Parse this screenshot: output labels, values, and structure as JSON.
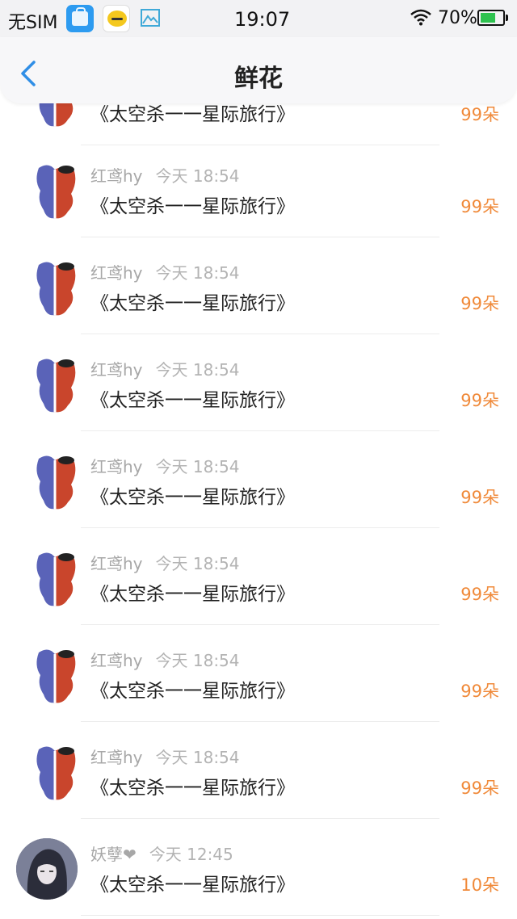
{
  "status_bar": {
    "carrier": "无SIM",
    "time": "19:07",
    "battery": "70%",
    "battery_fraction": 0.7,
    "icons": [
      "vivo-appstore-icon",
      "qq-icon",
      "gallery-icon",
      "wifi-icon",
      "battery-icon"
    ]
  },
  "header": {
    "title": "鲜花",
    "back_icon": "chevron-left-icon"
  },
  "colors": {
    "accent_blue": "#2f8ee6",
    "count_orange": "#f08a3a",
    "meta_gray": "#a7a7a7"
  },
  "partial_row": {
    "gift": "《太空杀一一星际旅行》",
    "count": "99朵"
  },
  "rows": [
    {
      "name": "红鸢hy",
      "time": "今天 18:54",
      "gift": "《太空杀一一星际旅行》",
      "count": "99朵"
    },
    {
      "name": "红鸢hy",
      "time": "今天 18:54",
      "gift": "《太空杀一一星际旅行》",
      "count": "99朵"
    },
    {
      "name": "红鸢hy",
      "time": "今天 18:54",
      "gift": "《太空杀一一星际旅行》",
      "count": "99朵"
    },
    {
      "name": "红鸢hy",
      "time": "今天 18:54",
      "gift": "《太空杀一一星际旅行》",
      "count": "99朵"
    },
    {
      "name": "红鸢hy",
      "time": "今天 18:54",
      "gift": "《太空杀一一星际旅行》",
      "count": "99朵"
    },
    {
      "name": "红鸢hy",
      "time": "今天 18:54",
      "gift": "《太空杀一一星际旅行》",
      "count": "99朵"
    },
    {
      "name": "红鸢hy",
      "time": "今天 18:54",
      "gift": "《太空杀一一星际旅行》",
      "count": "99朵"
    },
    {
      "name": "妖孽❤",
      "time": "今天 12:45",
      "gift": "《太空杀一一星际旅行》",
      "count": "10朵"
    }
  ]
}
